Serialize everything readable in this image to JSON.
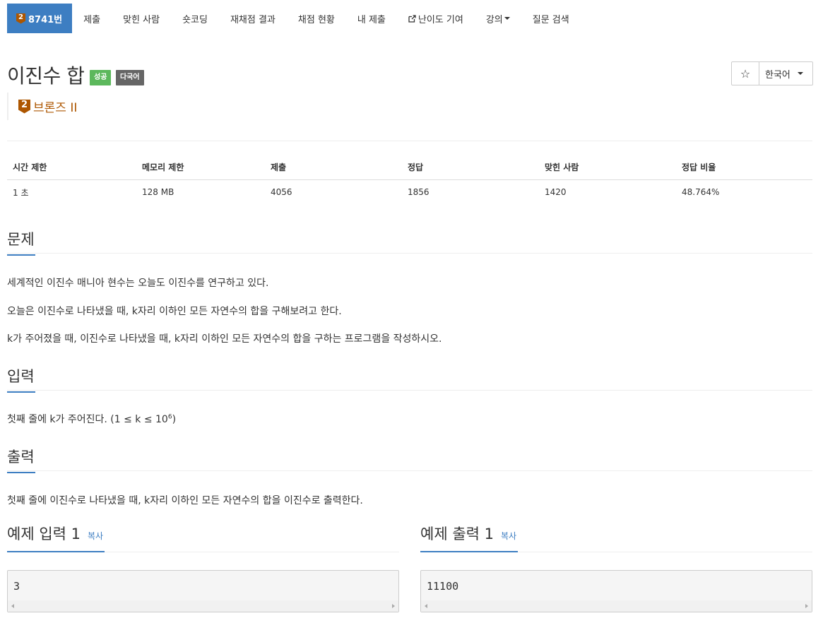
{
  "nav": {
    "problem_tier": "2",
    "problem_id_label": "8741번",
    "items": [
      "제출",
      "맞힌 사람",
      "숏코딩",
      "재채점 결과",
      "채점 현황",
      "내 제출",
      "난이도 기여",
      "강의",
      "질문 검색"
    ]
  },
  "header": {
    "title": "이진수 합",
    "label_success": "성공",
    "label_multilang": "다국어",
    "star_glyph": "☆",
    "language": "한국어",
    "tier_number": "2",
    "tier_name": "브론즈 II"
  },
  "stats": {
    "headers": [
      "시간 제한",
      "메모리 제한",
      "제출",
      "정답",
      "맞힌 사람",
      "정답 비율"
    ],
    "values": [
      "1 초",
      "128 MB",
      "4056",
      "1856",
      "1420",
      "48.764%"
    ]
  },
  "problem": {
    "title": "문제",
    "paragraphs": [
      "세계적인 이진수 매니아 현수는 오늘도 이진수를 연구하고 있다.",
      "오늘은 이진수로 나타냈을 때, k자리 이하인 모든 자연수의 합을 구해보려고 한다.",
      "k가 주어졌을 때, 이진수로 나타냈을 때, k자리 이하인 모든 자연수의 합을 구하는 프로그램을 작성하시오."
    ]
  },
  "input": {
    "title": "입력",
    "text_before": "첫째 줄에 k가 주어진다. (1 ≤ k ≤ 10",
    "exponent": "6",
    "text_after": ")"
  },
  "output": {
    "title": "출력",
    "text": "첫째 줄에 이진수로 나타냈을 때, k자리 이하인 모든 자연수의 합을 이진수로 출력한다."
  },
  "samples": {
    "input_title": "예제 입력 1",
    "output_title": "예제 출력 1",
    "copy_label": "복사",
    "input_value": "3",
    "output_value": "11100"
  },
  "colors": {
    "accent": "#3d7ec2",
    "bronze": "#ad5600",
    "success": "#5cb85c",
    "multilang": "#666666"
  }
}
